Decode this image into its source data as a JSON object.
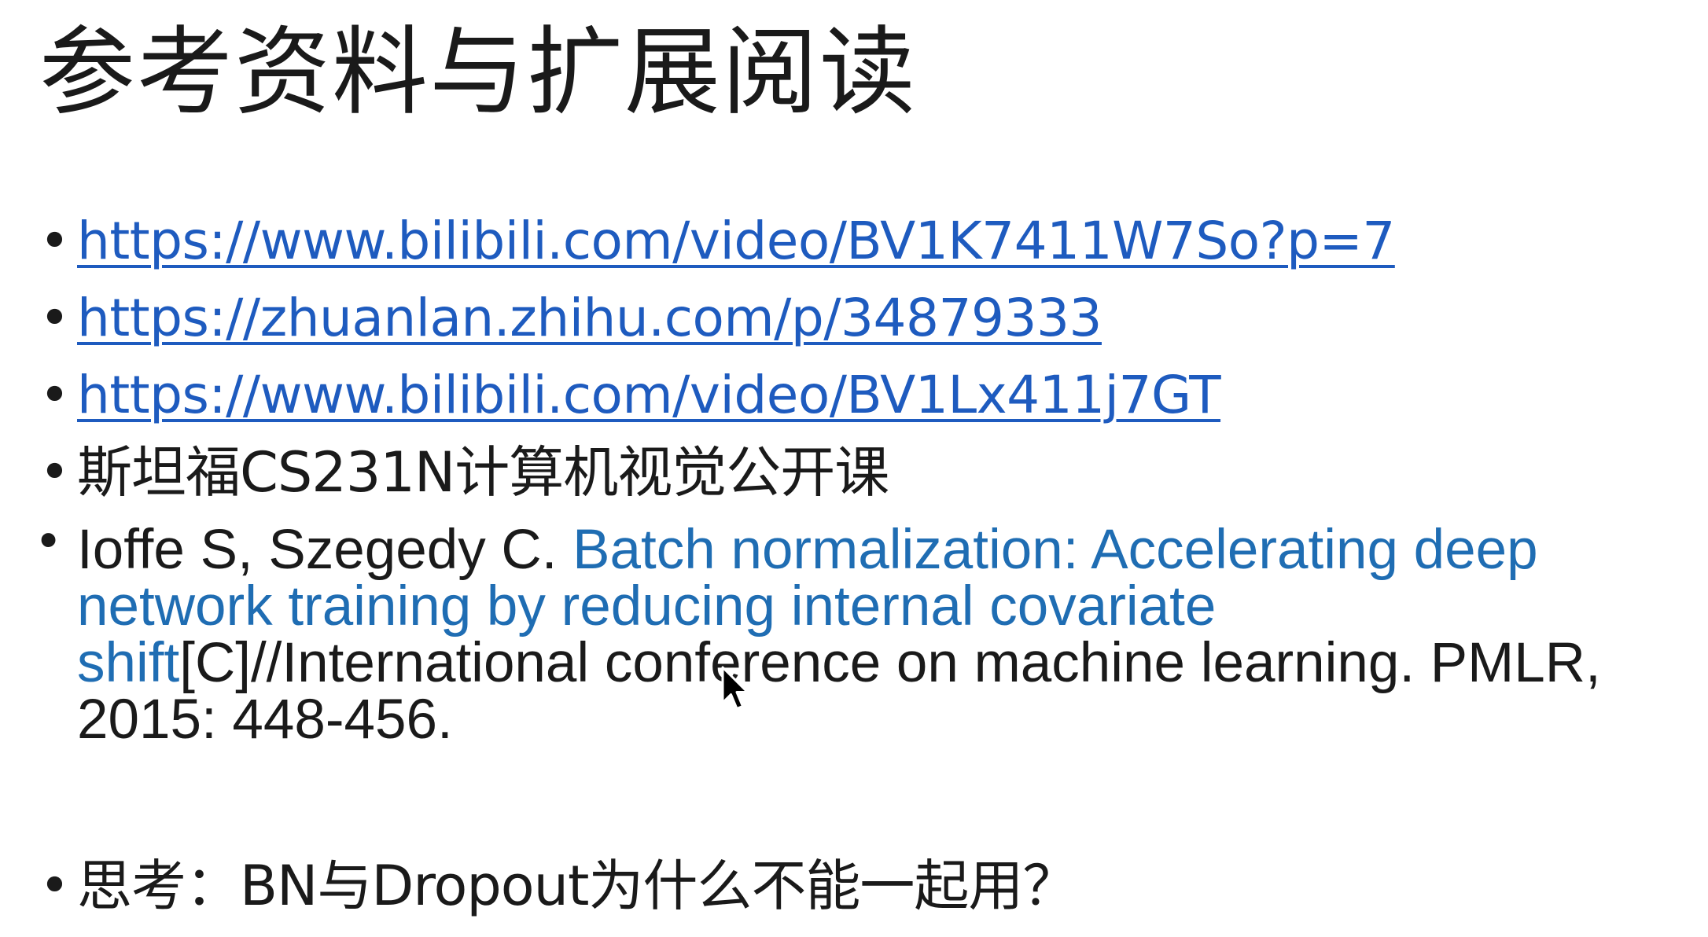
{
  "slide": {
    "title": "参考资料与扩展阅读",
    "links": [
      "https://www.bilibili.com/video/BV1K7411W7So?p=7",
      "https://zhuanlan.zhihu.com/p/34879333",
      "https://www.bilibili.com/video/BV1Lx411j7GT"
    ],
    "course": "斯坦福CS231N计算机视觉公开课",
    "reference": {
      "authors": "Ioffe S, Szegedy C. ",
      "title": "Batch normalization: Accelerating deep network training by reducing internal covariate shift",
      "rest": "[C]//International conference on machine learning. PMLR, 2015: 448-456."
    },
    "question": "思考：BN与Dropout为什么不能一起用？"
  },
  "colors": {
    "link": "#1e5bbf",
    "reference_title": "#1f6db3",
    "text": "#1a1a1a"
  },
  "icons": {
    "cursor": "mouse-pointer-icon"
  }
}
